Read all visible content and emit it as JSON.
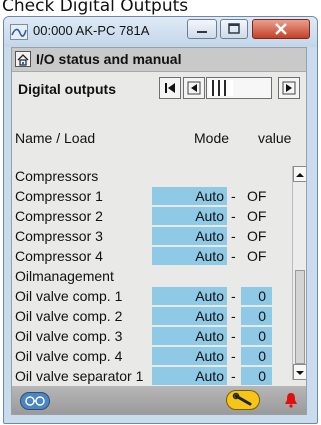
{
  "caption": "Check Digital Outputs",
  "window": {
    "title": "00:000 AK-PC 781A",
    "app_icon": "wave-icon",
    "buttons": [
      "minimize-icon",
      "maximize-icon",
      "close-icon"
    ]
  },
  "header": {
    "title": "I/O status and manual",
    "home_icon": "home-icon"
  },
  "toolbar": {
    "label": "Digital outputs",
    "first_icon": "first-page-icon",
    "prev_icon": "prev-page-icon",
    "next_icon": "next-page-icon"
  },
  "columns": {
    "name": "Name / Load",
    "mode": "Mode",
    "value": "value"
  },
  "rows": [
    {
      "name": "Compressors",
      "mode": "",
      "value": ""
    },
    {
      "name": "Compressor 1",
      "mode": "Auto",
      "value": "OF"
    },
    {
      "name": "Compressor 2",
      "mode": "Auto",
      "value": "OF"
    },
    {
      "name": "Compressor 3",
      "mode": "Auto",
      "value": "OF"
    },
    {
      "name": "Compressor 4",
      "mode": "Auto",
      "value": "OF"
    },
    {
      "name": "Oilmanagement",
      "mode": "",
      "value": ""
    },
    {
      "name": "Oil valve comp. 1",
      "mode": "Auto",
      "value": "0"
    },
    {
      "name": "Oil valve comp. 2",
      "mode": "Auto",
      "value": "0"
    },
    {
      "name": "Oil valve comp. 3",
      "mode": "Auto",
      "value": "0"
    },
    {
      "name": "Oil valve comp. 4",
      "mode": "Auto",
      "value": "0"
    },
    {
      "name": "Oil valve separator 1",
      "mode": "Auto",
      "value": "0"
    }
  ],
  "footer": {
    "left_icon": "glasses-icon",
    "tool_icon": "wrench-icon",
    "alarm_icon": "bell-icon"
  },
  "colors": {
    "mode_cell": "#8ecae6",
    "window_frame": "#c9dced",
    "alarm": "#e01010"
  }
}
